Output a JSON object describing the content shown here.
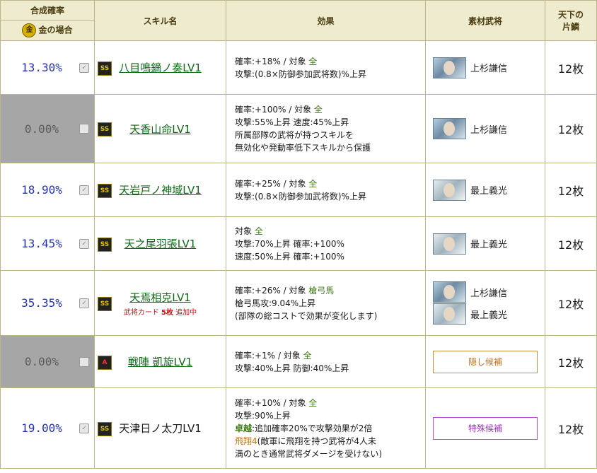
{
  "header": {
    "rate_title": "合成確率",
    "gold_icon": "金",
    "gold_label": "金の場合",
    "skill_name": "スキル名",
    "effect": "効果",
    "material": "素材武将",
    "piece_line1": "天下の",
    "piece_line2": "片鱗"
  },
  "rows": [
    {
      "rate": "13.30%",
      "checked": true,
      "grade": "SS",
      "skill": "八目鳴鏑ノ奏LV1",
      "effect": [
        "確率:+18% / 対象 ",
        "全",
        "攻撃:(0.8×防御参加武将数)%上昇"
      ],
      "material": [
        "上杉謙信"
      ],
      "count": "12枚"
    },
    {
      "rate": "0.00%",
      "checked": false,
      "grade": "SS",
      "skill": "天香山命LV1",
      "effect": [
        "確率:+100% / 対象 ",
        "全",
        "攻撃:55%上昇 速度:45%上昇",
        "所属部隊の武将が持つスキルを",
        "無効化や発動率低下スキルから保護"
      ],
      "material": [
        "上杉謙信"
      ],
      "count": "12枚"
    },
    {
      "rate": "18.90%",
      "checked": true,
      "grade": "SS",
      "skill": "天岩戸ノ神域LV1",
      "effect": [
        "確率:+25% / 対象 ",
        "全",
        "攻撃:(0.8×防御参加武将数)%上昇"
      ],
      "material": [
        "最上義光"
      ],
      "count": "12枚"
    },
    {
      "rate": "13.45%",
      "checked": true,
      "grade": "SS",
      "skill": "天之尾羽張LV1",
      "effect": [
        "対象 ",
        "全",
        "攻撃:70%上昇 確率:+100%",
        "速度:50%上昇 確率:+100%"
      ],
      "material": [
        "最上義光"
      ],
      "count": "12枚"
    },
    {
      "rate": "35.35%",
      "checked": true,
      "grade": "SS",
      "skill": "天焉相克LV1",
      "sub": [
        "武将カード ",
        "5枚",
        " 追加中"
      ],
      "effect": [
        "確率:+26% / 対象 ",
        "槍弓馬",
        "槍弓馬攻:9.04%上昇",
        "(部隊の総コストで効果が変化します)"
      ],
      "material": [
        "上杉謙信",
        "最上義光"
      ],
      "count": "12枚"
    },
    {
      "rate": "0.00%",
      "checked": false,
      "grade": "A",
      "skill": "戦陣 凱旋LV1",
      "effect": [
        "確率:+1% / 対象 ",
        "全",
        "攻撃:40%上昇 防御:40%上昇"
      ],
      "candidate": "隠し候補",
      "count": "12枚"
    },
    {
      "rate": "19.00%",
      "checked": true,
      "grade": "SS",
      "skill": "天津日ノ太刀LV1",
      "effect": [
        "確率:+10% / 対象 ",
        "全",
        "攻撃:90%上昇",
        "卓越",
        ":追加確率20%で攻撃効果が2倍",
        "飛翔4",
        "(敵軍に飛翔を持つ武将が4人未",
        "満のとき通常武将ダメージを受けない)"
      ],
      "candidate": "特殊候補",
      "count": "12枚"
    }
  ],
  "colors": {
    "header_bg": "#efebcf",
    "rate_text": "#2432b0",
    "skill_link": "#0c6a16",
    "target_green": "#3d7a10",
    "disabled_bg": "#a6a6a6"
  }
}
